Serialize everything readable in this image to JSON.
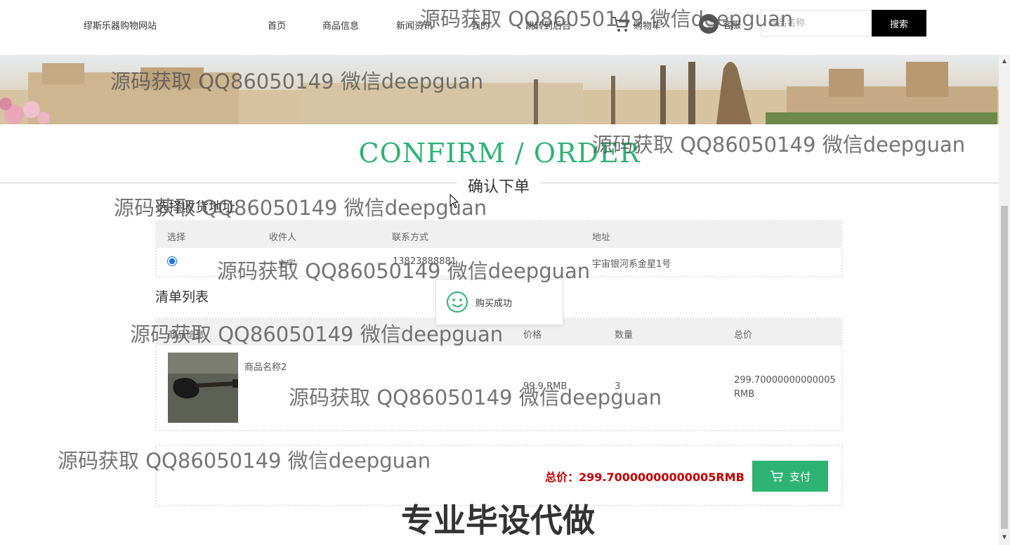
{
  "header": {
    "site_name": "缪斯乐器购物网站",
    "nav": [
      "首页",
      "商品信息",
      "新闻资讯",
      "我的",
      "跳转到后台"
    ],
    "cart_label": "购物车",
    "service_label": "客服",
    "search_placeholder": "商品名称",
    "search_button": "搜索"
  },
  "page": {
    "title_en": "CONFIRM / ORDER",
    "title_cn": "确认下单"
  },
  "address_section": {
    "heading": "选择收货地址",
    "columns": [
      "选择",
      "收件人",
      "联系方式",
      "地址"
    ],
    "rows": [
      {
        "selected": true,
        "name": "主宇",
        "phone": "13823888881",
        "address": "宇宙银河系金星1号"
      }
    ]
  },
  "order_section": {
    "heading": "清单列表",
    "columns": [
      "商品信息",
      "价格",
      "数量",
      "总价"
    ],
    "items": [
      {
        "name": "商品名称2",
        "price": "99.9 RMB",
        "quantity": "3",
        "total": "299.70000000000005",
        "total_unit": "RMB",
        "image": "guitar-image"
      }
    ]
  },
  "summary": {
    "total_label": "总价：299.70000000000005RMB",
    "pay_button": "支付"
  },
  "toast": {
    "message": "购买成功",
    "icon": "smile-icon"
  },
  "watermarks": {
    "text": "源码获取 QQ86050149 微信deepguan",
    "banner_text": "专业毕设代做"
  },
  "colors": {
    "accent_green": "#2db373",
    "price_red": "#c40000",
    "search_button_bg": "#000000"
  }
}
